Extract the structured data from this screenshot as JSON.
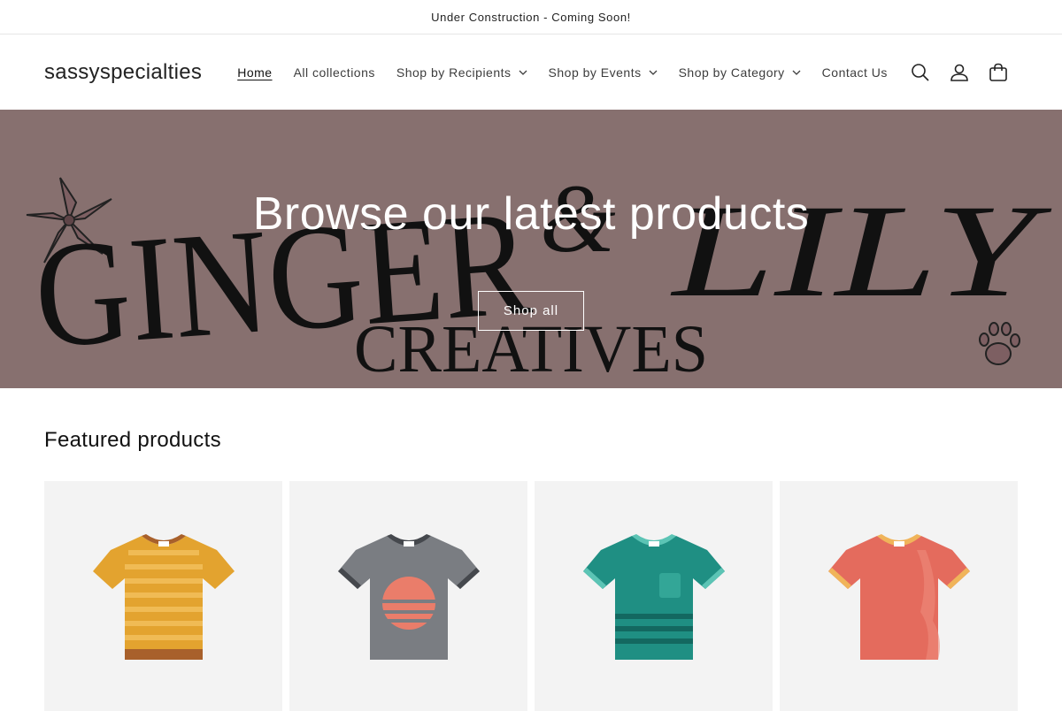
{
  "announcement": {
    "text": "Under Construction - Coming Soon!"
  },
  "header": {
    "logo": "sassyspecialties",
    "nav": [
      {
        "label": "Home",
        "active": true,
        "dropdown": false
      },
      {
        "label": "All collections",
        "active": false,
        "dropdown": false
      },
      {
        "label": "Shop by Recipients",
        "active": false,
        "dropdown": true
      },
      {
        "label": "Shop by Events",
        "active": false,
        "dropdown": true
      },
      {
        "label": "Shop by Category",
        "active": false,
        "dropdown": true
      },
      {
        "label": "Contact Us",
        "active": false,
        "dropdown": false
      }
    ],
    "icons": [
      "search-icon",
      "account-icon",
      "cart-icon"
    ]
  },
  "hero": {
    "title": "Browse our latest products",
    "button_label": "Shop all",
    "background_color": "#87706f",
    "image_text_top_left": "GINGER",
    "image_text_amp": "&",
    "image_text_top_right": "LILY",
    "image_text_bottom": "CREATIVES"
  },
  "featured": {
    "title": "Featured products",
    "products": [
      {
        "icon": "striped-orange-tshirt-icon",
        "color": "#e3a32f"
      },
      {
        "icon": "gray-sunset-tshirt-icon",
        "color": "#7a7d82"
      },
      {
        "icon": "teal-pocket-tshirt-icon",
        "color": "#1f8f83"
      },
      {
        "icon": "coral-tshirt-icon",
        "color": "#e46b5d"
      }
    ]
  }
}
